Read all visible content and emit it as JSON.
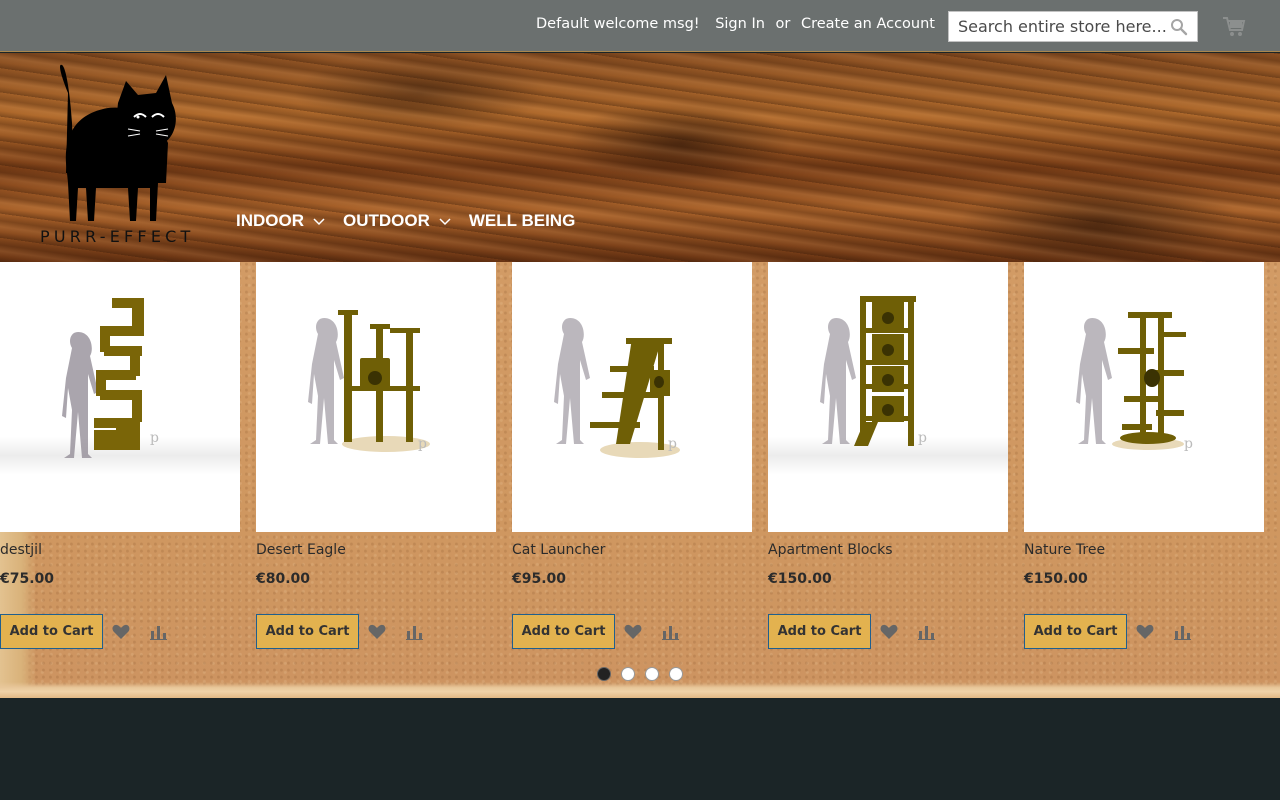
{
  "topbar": {
    "welcome": "Default welcome msg!",
    "sign_in": "Sign In",
    "or": "or",
    "create_account": "Create an Account",
    "search_placeholder": "Search entire store here..."
  },
  "logo": {
    "text": "PURR-EFFECT"
  },
  "nav": [
    {
      "label": "INDOOR",
      "has_dropdown": true
    },
    {
      "label": "OUTDOOR",
      "has_dropdown": true
    },
    {
      "label": "WELL BEING",
      "has_dropdown": false
    }
  ],
  "products": [
    {
      "name": "destjil",
      "price": "€75.00",
      "add_label": "Add to Cart"
    },
    {
      "name": "Desert Eagle",
      "price": "€80.00",
      "add_label": "Add to Cart"
    },
    {
      "name": "Cat Launcher",
      "price": "€95.00",
      "add_label": "Add to Cart"
    },
    {
      "name": "Apartment Blocks",
      "price": "€150.00",
      "add_label": "Add to Cart"
    },
    {
      "name": "Nature Tree",
      "price": "€150.00",
      "add_label": "Add to Cart"
    }
  ],
  "carousel": {
    "pages": 4,
    "active": 1
  },
  "colors": {
    "topbar": "#6b706f",
    "button": "#e3b24f",
    "footer": "#1b2527",
    "furniture": "#7a6508"
  },
  "icons": [
    "search-icon",
    "cart-icon",
    "chevron-down-icon",
    "heart-icon",
    "compare-icon",
    "cat-logo-icon"
  ]
}
